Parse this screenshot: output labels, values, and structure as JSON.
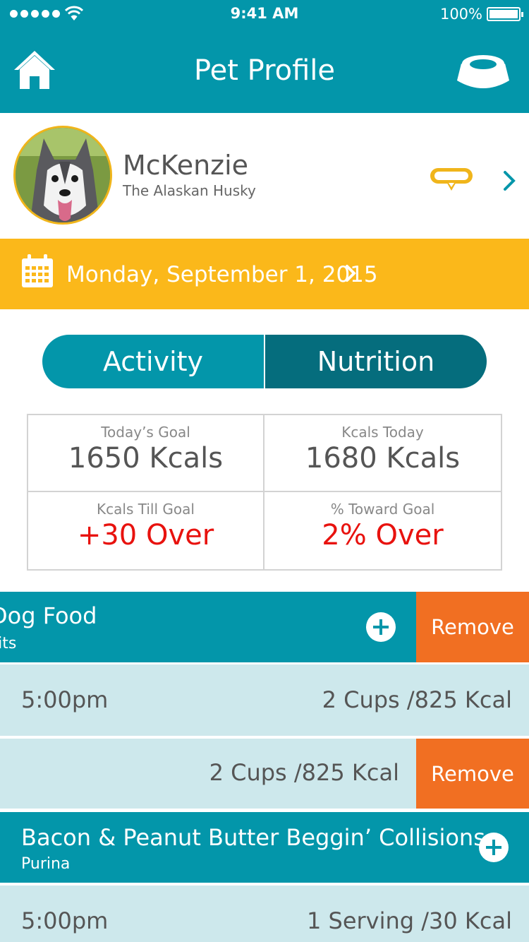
{
  "status": {
    "time": "9:41 AM",
    "battery": "100%"
  },
  "header": {
    "title": "Pet Profile"
  },
  "pet": {
    "name": "McKenzie",
    "breed": "The Alaskan Husky"
  },
  "date": {
    "label": "Monday, September 1, 2015"
  },
  "tabs": [
    {
      "label": "Activity"
    },
    {
      "label": "Nutrition"
    }
  ],
  "stats": [
    {
      "label": "Today’s Goal",
      "value": "1650 Kcals"
    },
    {
      "label": "Kcals Today",
      "value": "1680 Kcals"
    },
    {
      "label": "Kcals Till Goal",
      "value": "+30 Over"
    },
    {
      "label": "% Toward Goal",
      "value": "2% Over"
    }
  ],
  "foods": [
    {
      "name": "Dog Food",
      "brand": "Bits",
      "remove_label": "Remove",
      "entries": [
        {
          "time": "5:00pm",
          "amount": "2 Cups /825 Kcal"
        },
        {
          "time": "",
          "amount": "2 Cups /825 Kcal",
          "remove_label": "Remove"
        }
      ]
    },
    {
      "name": "Bacon & Peanut Butter Beggin’ Collisions",
      "brand": "Purina",
      "entries": [
        {
          "time": "5:00pm",
          "amount": "1 Serving /30 Kcal"
        }
      ]
    }
  ],
  "colors": {
    "primary": "#0396aa",
    "primary_dark": "#056d7d",
    "accent": "#fbb81a",
    "remove": "#f16f22",
    "over": "#e8120e",
    "entry_bg": "#cde8ec"
  }
}
